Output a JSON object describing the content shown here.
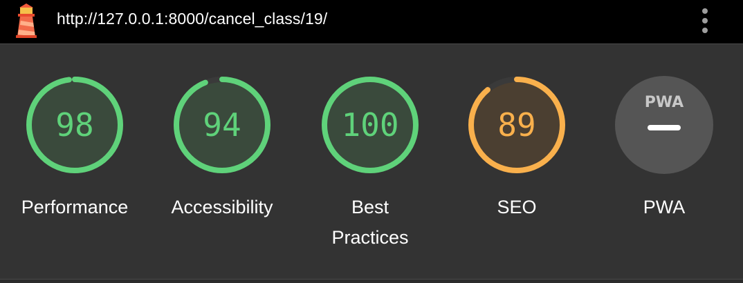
{
  "topbar": {
    "url": "http://127.0.0.1:8000/cancel_class/19/",
    "logo_icon": "lighthouse-icon",
    "menu_icon": "more-vert-icon"
  },
  "colors": {
    "pass": "#5fd27a",
    "average": "#f9b04c",
    "pass_fill": "#3a4a3c",
    "average_fill": "#4b3f31",
    "track": "#3a3a3a",
    "pwa_bg": "#555555"
  },
  "gauges": [
    {
      "score": "98",
      "label": "Performance",
      "rating": "pass"
    },
    {
      "score": "94",
      "label": "Accessibility",
      "rating": "pass"
    },
    {
      "score": "100",
      "label": "Best Practices",
      "rating": "pass"
    },
    {
      "score": "89",
      "label": "SEO",
      "rating": "average"
    }
  ],
  "pwa": {
    "badge_text": "PWA",
    "label": "PWA",
    "icon": "pwa-badge-icon"
  }
}
